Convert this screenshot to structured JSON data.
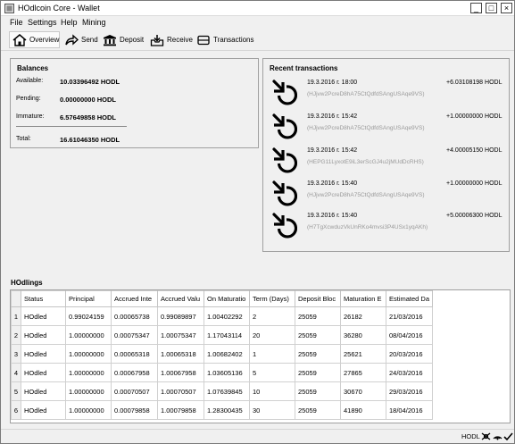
{
  "window": {
    "title": "HOdlcoin Core - Wallet",
    "min_glyph": "_",
    "max_glyph": "□",
    "close_glyph": "×"
  },
  "menu": [
    "File",
    "Settings",
    "Help",
    "Mining"
  ],
  "toolbar": {
    "overview": "Overview",
    "send": "Send",
    "deposit": "Deposit",
    "receive": "Receive",
    "transactions": "Transactions"
  },
  "balances": {
    "title": "Balances",
    "available_label": "Available:",
    "available": "10.03396492 HODL",
    "pending_label": "Pending:",
    "pending": "0.00000000 HODL",
    "immature_label": "Immature:",
    "immature": "6.57649858 HODL",
    "total_label": "Total:",
    "total": "16.61046350 HODL"
  },
  "recent": {
    "title": "Recent transactions",
    "items": [
      {
        "date": "19.3.2016 г. 18:00",
        "amount": "+6.03108198 HODL",
        "address": "(HJjvw2PcreD8hA75CtQdfdSAngUSAqe9VS)"
      },
      {
        "date": "19.3.2016 г. 15:42",
        "amount": "+1.00000000 HODL",
        "address": "(HJjvw2PcreD8hA75CtQdfdSAngUSAqe9VS)"
      },
      {
        "date": "19.3.2016 г. 15:42",
        "amount": "+4.00005150 HODL",
        "address": "(HEPG11LyxotE9iL3erScGJ4u2jMUdDcRHS)"
      },
      {
        "date": "19.3.2016 г. 15:40",
        "amount": "+1.00000000 HODL",
        "address": "(HJjvw2PcreD8hA75CtQdfdSAngUSAqe9VS)"
      },
      {
        "date": "19.3.2016 г. 15:40",
        "amount": "+5.00006300 HODL",
        "address": "(H7TgXcwduzVkUnRKo4mvsi3P4USx1yqAKh)"
      }
    ]
  },
  "holdings": {
    "title": "HOdlings",
    "columns": [
      "Status",
      "Principal",
      "Accrued Inte",
      "Accrued Valu",
      "On Maturatio",
      "Term (Days)",
      "Deposit Bloc",
      "Maturation E",
      "Estimated Da"
    ],
    "rows": [
      [
        "1",
        "HOdled",
        "0.99024159",
        "0.00065738",
        "0.99089897",
        "1.00402292",
        "2",
        "25059",
        "26182",
        "21/03/2016"
      ],
      [
        "2",
        "HOdled",
        "1.00000000",
        "0.00075347",
        "1.00075347",
        "1.17043114",
        "20",
        "25059",
        "36280",
        "08/04/2016"
      ],
      [
        "3",
        "HOdled",
        "1.00000000",
        "0.00065318",
        "1.00065318",
        "1.00682402",
        "1",
        "25059",
        "25621",
        "20/03/2016"
      ],
      [
        "4",
        "HOdled",
        "1.00000000",
        "0.00067958",
        "1.00067958",
        "1.03605136",
        "5",
        "25059",
        "27865",
        "24/03/2016"
      ],
      [
        "5",
        "HOdled",
        "1.00000000",
        "0.00070507",
        "1.00070507",
        "1.07639845",
        "10",
        "25059",
        "30670",
        "29/03/2016"
      ],
      [
        "6",
        "HOdled",
        "1.00000000",
        "0.00079858",
        "1.00079858",
        "1.28300435",
        "30",
        "25059",
        "41890",
        "18/04/2016"
      ]
    ]
  },
  "status": {
    "unit": "HODL"
  },
  "colors": {
    "accent": "#000000",
    "muted_text": "#9a9a9a",
    "panel_border": "#a0a0a0"
  },
  "icons": [
    "app-logo-icon",
    "home-icon",
    "send-arrow-icon",
    "bank-icon",
    "receive-inbox-icon",
    "list-icon",
    "incoming-tx-icon",
    "connections-icon",
    "synced-check-icon"
  ]
}
